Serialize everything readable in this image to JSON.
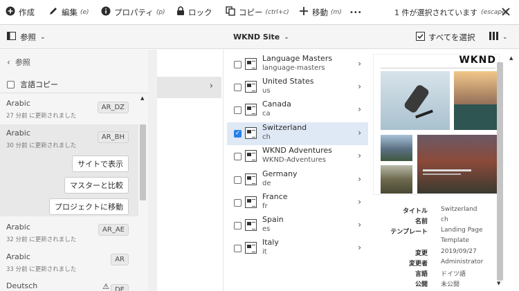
{
  "actionbar": {
    "create": "作成",
    "edit": "編集",
    "edit_shortcut": "(e)",
    "properties": "プロパティ",
    "properties_shortcut": "(p)",
    "lock": "ロック",
    "copy": "コピー",
    "copy_shortcut": "(ctrl+c)",
    "move": "移動",
    "move_shortcut": "(m)",
    "more": "•••",
    "selection": "1 件が選択されています",
    "escape": "(escape)"
  },
  "toolbar": {
    "references": "参照",
    "site": "WKND Site",
    "select_all": "すべてを選択"
  },
  "rail": {
    "back": "参照",
    "language_copy": "言語コピー",
    "items": [
      {
        "name": "Arabic",
        "time": "27 分前 に更新されました",
        "tag": "AR_DZ"
      },
      {
        "name": "Arabic",
        "time": "30 分前 に更新されました",
        "tag": "AR_BH"
      },
      {
        "name": "Arabic",
        "time": "32 分前 に更新されました",
        "tag": "AR_AE"
      },
      {
        "name": "Arabic",
        "time": "33 分前 に更新されました",
        "tag": "AR"
      },
      {
        "name": "Deutsch",
        "time": "",
        "tag": "DE"
      }
    ],
    "buttons": {
      "view_on_site": "サイトで表示",
      "compare_master": "マスターと比較",
      "promote_project": "プロジェクトに移動"
    }
  },
  "column": {
    "rows": [
      {
        "title": "Language Masters",
        "name": "language-masters",
        "selected": false
      },
      {
        "title": "United States",
        "name": "us",
        "selected": false
      },
      {
        "title": "Canada",
        "name": "ca",
        "selected": false
      },
      {
        "title": "Switzerland",
        "name": "ch",
        "selected": true
      },
      {
        "title": "WKND Adventures",
        "name": "WKND-Adventures",
        "selected": false
      },
      {
        "title": "Germany",
        "name": "de",
        "selected": false
      },
      {
        "title": "France",
        "name": "fr",
        "selected": false
      },
      {
        "title": "Spain",
        "name": "es",
        "selected": false
      },
      {
        "title": "Italy",
        "name": "it",
        "selected": false
      }
    ]
  },
  "preview": {
    "logo": "WKND",
    "meta": {
      "title_label": "タイトル",
      "title": "Switzerland",
      "name_label": "名前",
      "name": "ch",
      "template_label": "テンプレート",
      "template_1": "Landing Page",
      "template_2": "Template",
      "modified_label": "変更",
      "modified": "2019/09/27",
      "modifier_label": "変更者",
      "modifier": "Administrator",
      "language_label": "言語",
      "language": "ドイツ語",
      "publish_label": "公開",
      "publish": "未公開"
    }
  }
}
